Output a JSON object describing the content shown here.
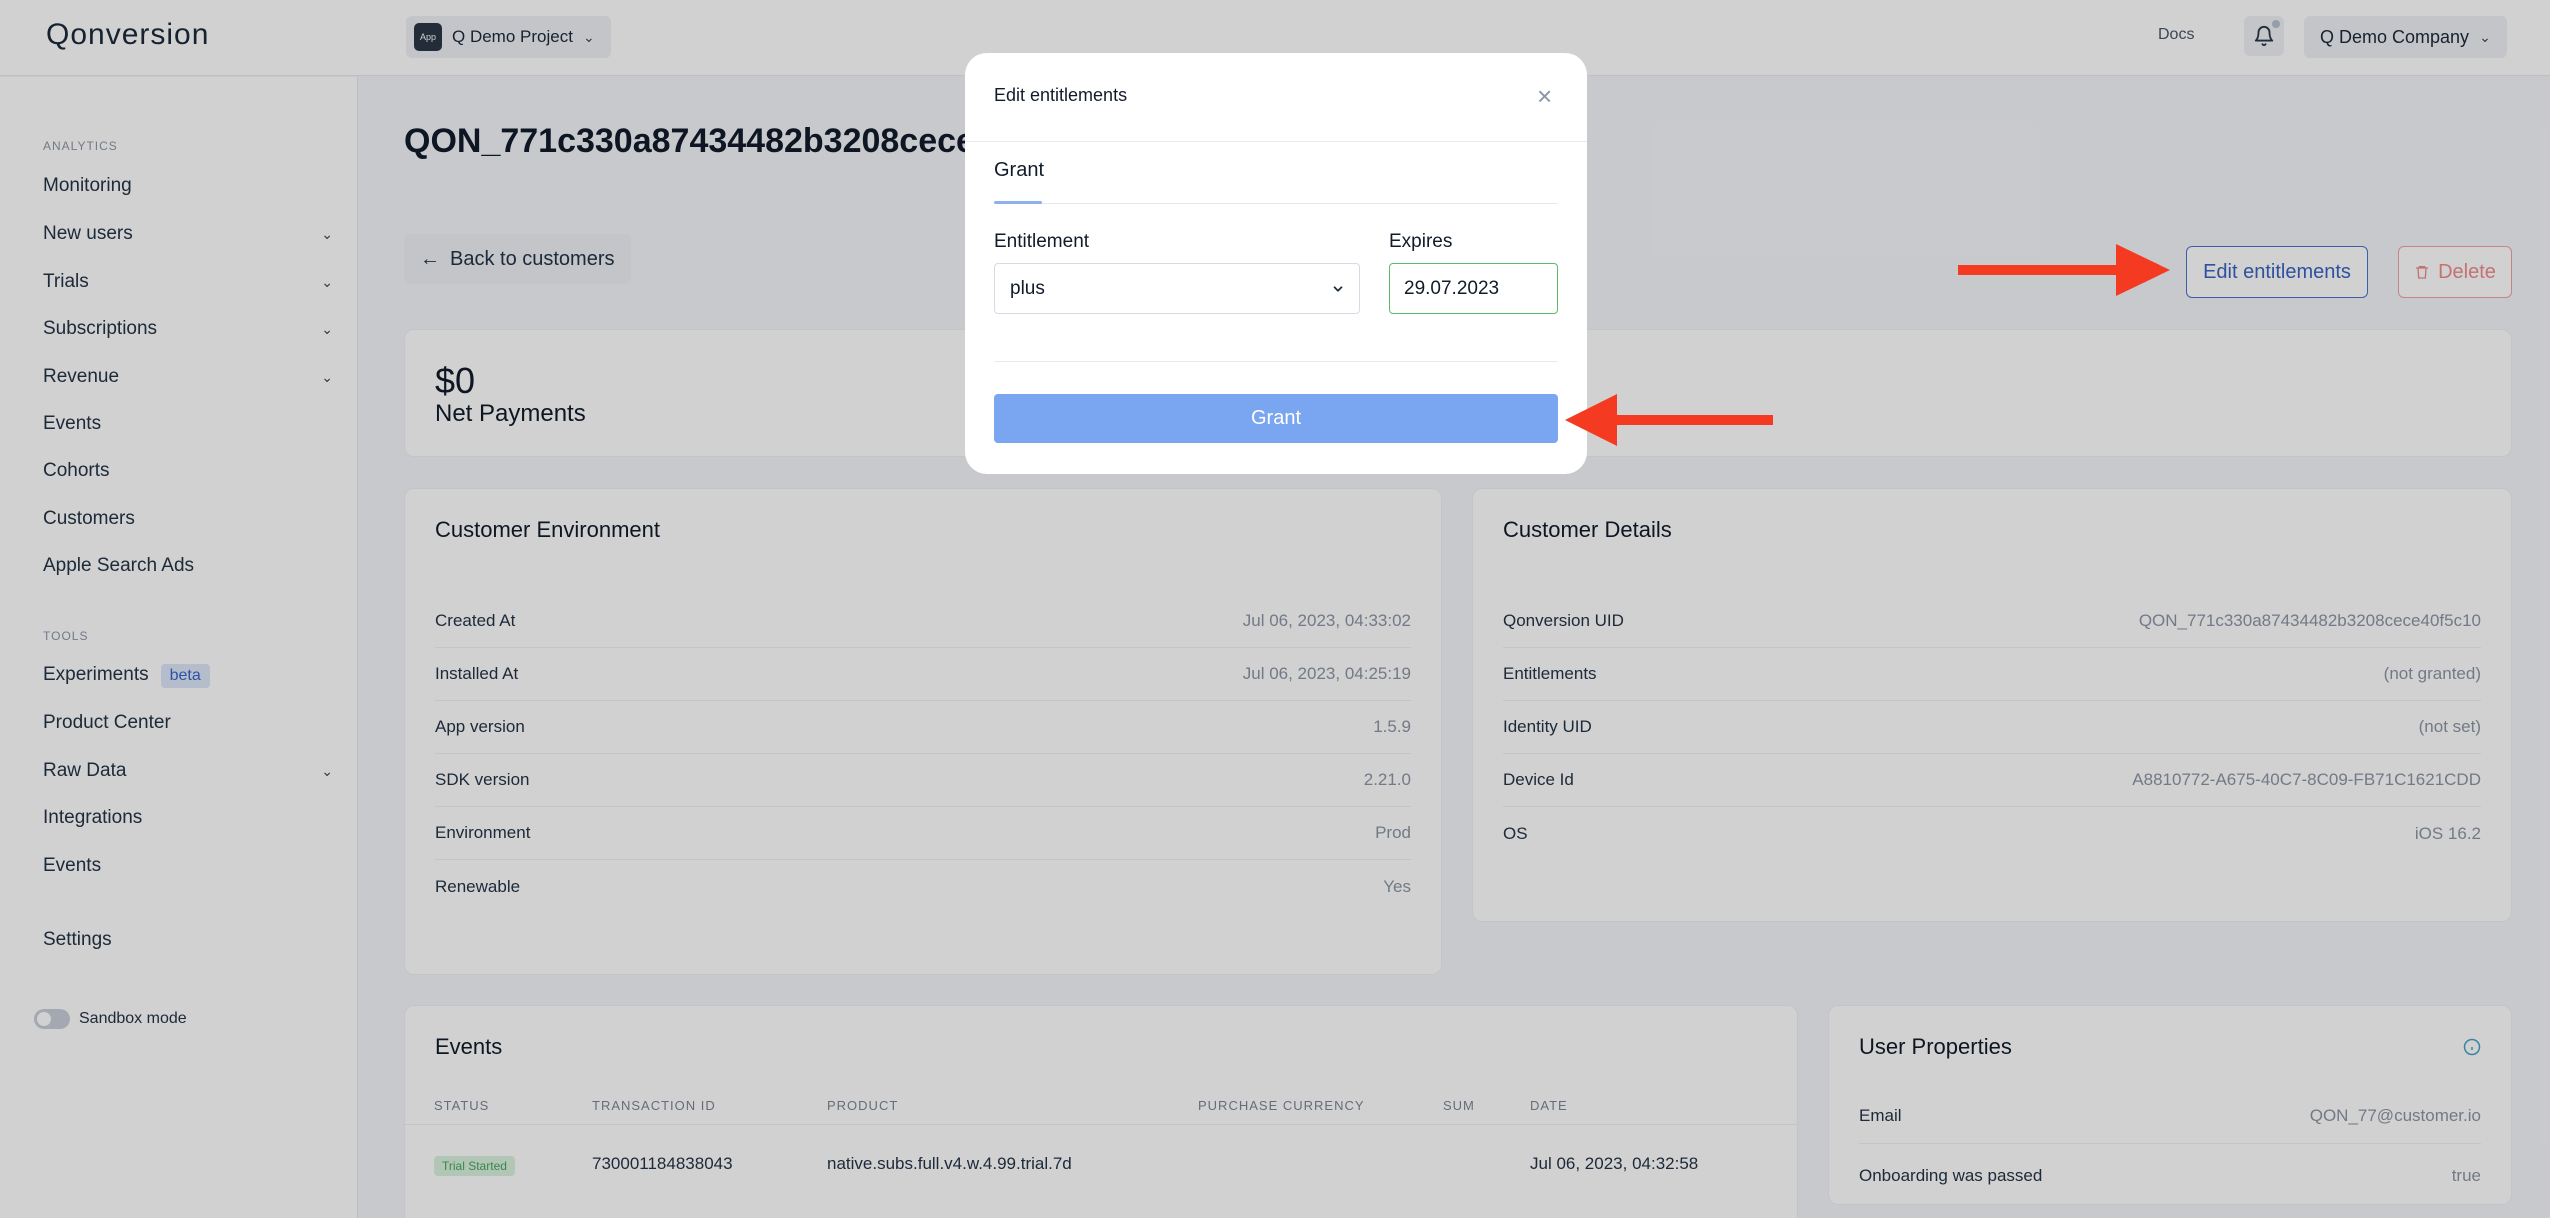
{
  "header": {
    "logo": "Qonversion",
    "project_badge": "App",
    "project_name": "Q Demo Project",
    "docs_label": "Docs",
    "company_name": "Q Demo Company"
  },
  "sidebar": {
    "analytics_label": "ANALYTICS",
    "analytics_items": [
      {
        "label": "Monitoring"
      },
      {
        "label": "New users"
      },
      {
        "label": "Trials"
      },
      {
        "label": "Subscriptions"
      },
      {
        "label": "Revenue"
      },
      {
        "label": "Events"
      },
      {
        "label": "Cohorts"
      },
      {
        "label": "Customers"
      },
      {
        "label": "Apple Search Ads"
      }
    ],
    "tools_label": "TOOLS",
    "tools_items": [
      {
        "label": "Experiments",
        "badge": "beta"
      },
      {
        "label": "Product Center"
      },
      {
        "label": "Raw Data"
      },
      {
        "label": "Integrations"
      },
      {
        "label": "Events"
      }
    ],
    "settings_label": "Settings",
    "sandbox_label": "Sandbox mode"
  },
  "main": {
    "title": "QON_771c330a87434482b3208cece",
    "back_label": "Back to customers",
    "edit_label": "Edit entitlements",
    "delete_label": "Delete",
    "net_payments": {
      "value": "$0",
      "label": "Net Payments"
    },
    "environment": {
      "title": "Customer Environment",
      "rows": [
        {
          "key": "Created At",
          "value": "Jul 06, 2023, 04:33:02"
        },
        {
          "key": "Installed At",
          "value": "Jul 06, 2023, 04:25:19"
        },
        {
          "key": "App version",
          "value": "1.5.9"
        },
        {
          "key": "SDK version",
          "value": "2.21.0"
        },
        {
          "key": "Environment",
          "value": "Prod"
        },
        {
          "key": "Renewable",
          "value": "Yes"
        }
      ]
    },
    "details": {
      "title": "Customer Details",
      "rows": [
        {
          "key": "Qonversion UID",
          "value": "QON_771c330a87434482b3208cece40f5c10"
        },
        {
          "key": "Entitlements",
          "value": "(not granted)"
        },
        {
          "key": "Identity UID",
          "value": "(not set)"
        },
        {
          "key": "Device Id",
          "value": "A8810772-A675-40C7-8C09-FB71C1621CDD"
        },
        {
          "key": "OS",
          "value": "iOS 16.2"
        }
      ]
    },
    "events": {
      "title": "Events",
      "columns": [
        "STATUS",
        "TRANSACTION ID",
        "PRODUCT",
        "PURCHASE CURRENCY",
        "SUM",
        "DATE"
      ],
      "rows": [
        {
          "status": "Trial Started",
          "transaction_id": "730001184838043",
          "product": "native.subs.full.v4.w.4.99.trial.7d",
          "currency": "",
          "sum": "",
          "date": "Jul 06, 2023, 04:32:58"
        }
      ]
    },
    "user_properties": {
      "title": "User Properties",
      "rows": [
        {
          "key": "Email",
          "value": "QON_77@customer.io"
        },
        {
          "key": "Onboarding was passed",
          "value": "true"
        }
      ]
    }
  },
  "modal": {
    "title": "Edit entitlements",
    "tab": "Grant",
    "entitlement_label": "Entitlement",
    "entitlement_value": "plus",
    "expires_label": "Expires",
    "expires_value": "29.07.2023",
    "grant_button": "Grant"
  },
  "colors": {
    "accent": "#4a74d0",
    "grant_button": "#7aa5f0",
    "annotation_arrow": "#f43a20",
    "delete": "#ef8b8b",
    "success": "#5dbb6a"
  }
}
